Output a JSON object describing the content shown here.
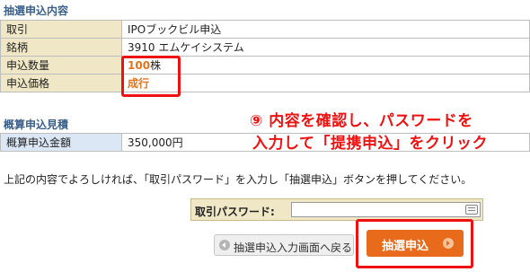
{
  "section1": {
    "title": "抽選申込内容",
    "rows": [
      {
        "label": "取引",
        "value": "IPOブックビル申込"
      },
      {
        "label": "銘柄",
        "value": "3910 エムケイシステム"
      },
      {
        "label": "申込数量",
        "value": "100",
        "unit": "株"
      },
      {
        "label": "申込価格",
        "value": "成行"
      }
    ]
  },
  "section2": {
    "title": "概算申込見積",
    "rows": [
      {
        "label": "概算申込金額",
        "value": "350,000円"
      }
    ]
  },
  "annotation": {
    "line1": "⑨ 内容を確認し、パスワードを",
    "line2": "入力して「提携申込」をクリック"
  },
  "instruction": "上記の内容でよろしければ、「取引パスワード」を入力し「抽選申込」ボタンを押してください。",
  "password": {
    "label": "取引パスワード:",
    "value": ""
  },
  "buttons": {
    "back": "抽選申込入力画面へ戻る",
    "submit": "抽選申込"
  },
  "colors": {
    "accent": "#e86a1b",
    "highlight": "#ee1111",
    "section_title": "#3a5f8a",
    "label_bg": "#efe7c6"
  },
  "icons": [
    "keyboard-icon",
    "arrow-left-icon",
    "arrow-right-icon"
  ]
}
